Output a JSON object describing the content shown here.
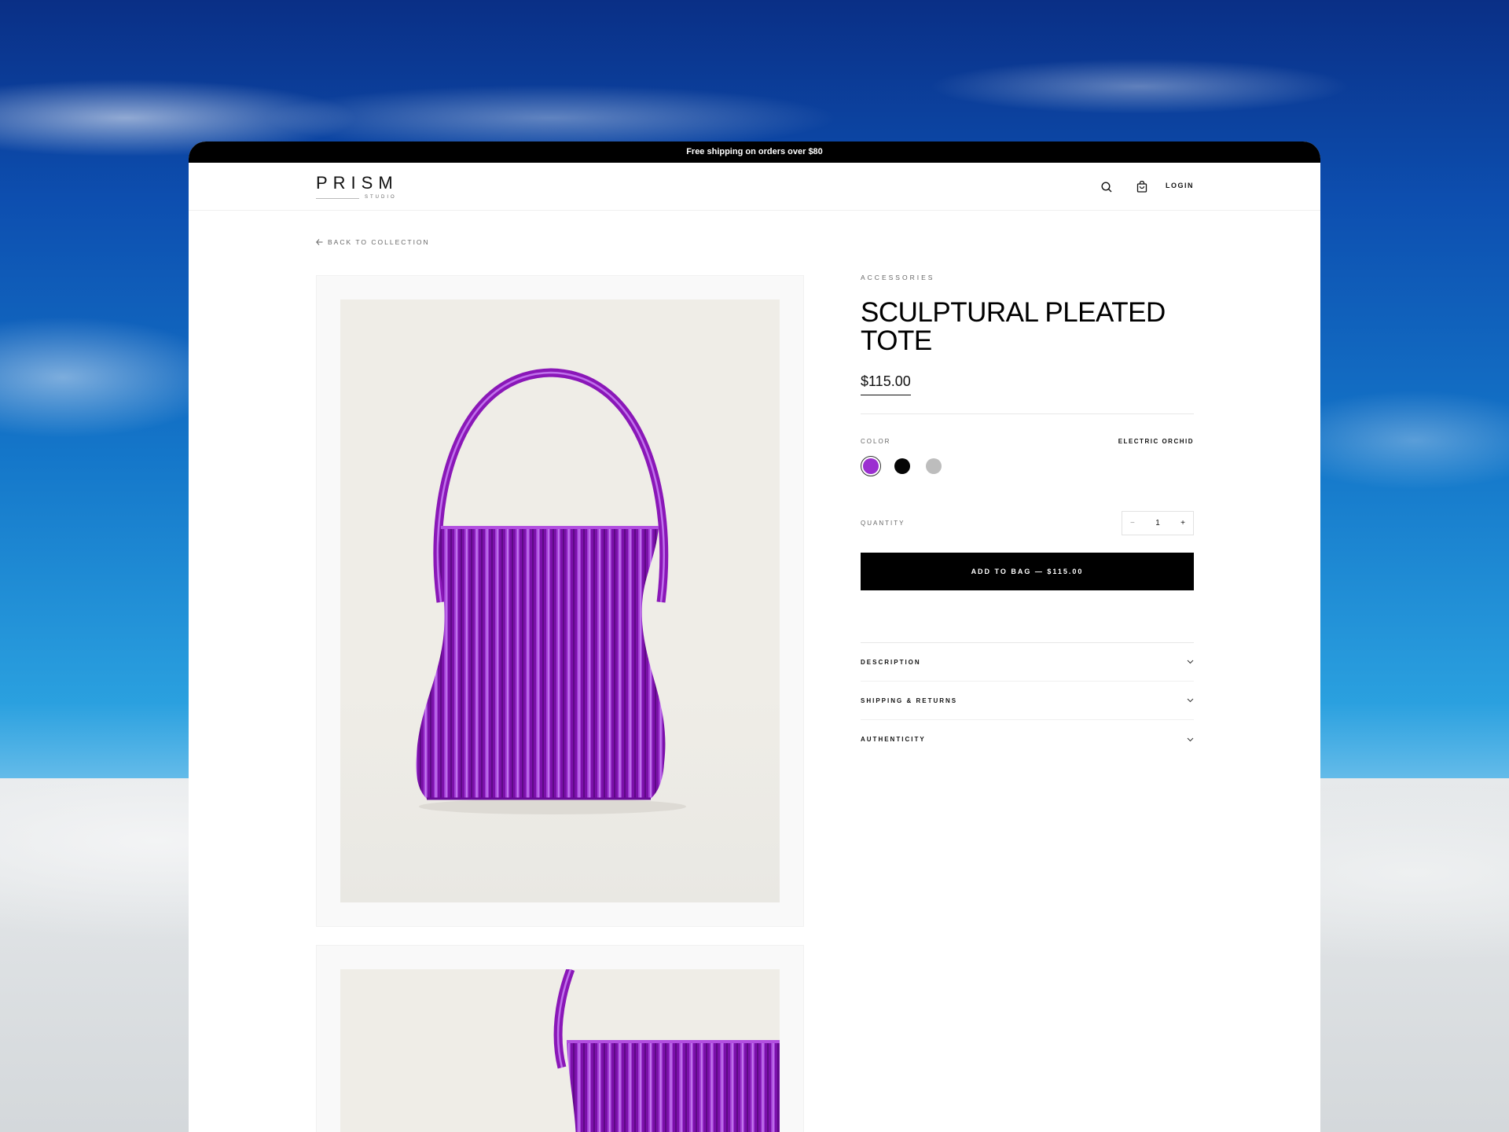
{
  "announcement": "Free shipping on orders over $80",
  "brand": {
    "name": "PRISM",
    "sub": "STUDIO"
  },
  "header": {
    "login": "LOGIN",
    "icons": [
      "search-icon",
      "bag-icon"
    ]
  },
  "back_link": "BACK TO COLLECTION",
  "product": {
    "category": "ACCESSORIES",
    "title": "SCULPTURAL PLEATED TOTE",
    "price": "$115.00",
    "color_label": "COLOR",
    "selected_color": "ELECTRIC ORCHID",
    "swatches": [
      {
        "name": "Electric Orchid",
        "hex": "#9b2fd0",
        "selected": true
      },
      {
        "name": "Black",
        "hex": "#050505",
        "selected": false
      },
      {
        "name": "Silver",
        "hex": "#bdbdbd",
        "selected": false
      }
    ],
    "quantity_label": "QUANTITY",
    "quantity": "1",
    "minus": "−",
    "plus": "+",
    "add_to_bag": "ADD TO BAG — $115.00"
  },
  "accordion": [
    {
      "label": "DESCRIPTION"
    },
    {
      "label": "SHIPPING & RETURNS"
    },
    {
      "label": "AUTHENTICITY"
    }
  ],
  "colors": {
    "bag_purple": "#8a17b8",
    "bag_highlight": "#b24fe0",
    "card_bg": "#efede7"
  }
}
